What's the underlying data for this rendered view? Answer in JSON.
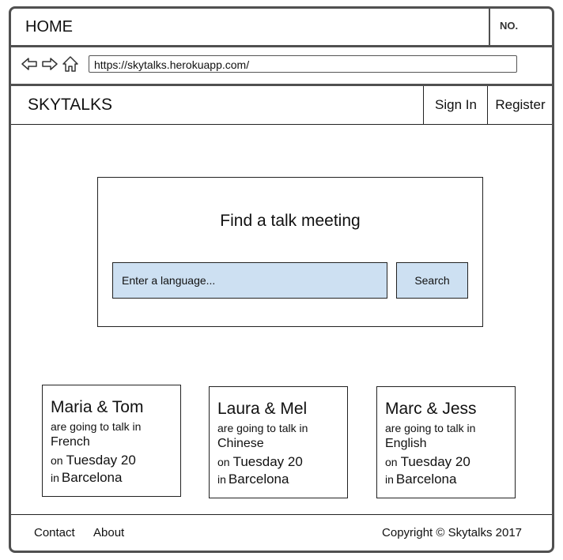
{
  "window": {
    "tab_title": "HOME",
    "no_label": "NO."
  },
  "browser": {
    "url": "https://skytalks.herokuapp.com/",
    "icons": [
      "back-arrow-icon",
      "forward-arrow-icon",
      "home-icon"
    ]
  },
  "header": {
    "brand": "SKYTALKS",
    "sign_in": "Sign In",
    "register": "Register"
  },
  "search": {
    "title": "Find a talk meeting",
    "placeholder": "Enter a language...",
    "button": "Search"
  },
  "cards": [
    {
      "names": "Maria & Tom",
      "line1": "are going to talk in",
      "language": "French",
      "on": "on",
      "day": "Tuesday 20",
      "in": "in",
      "city": "Barcelona"
    },
    {
      "names": "Laura & Mel",
      "line1": "are going to talk in",
      "language": "Chinese",
      "on": "on",
      "day": "Tuesday 20",
      "in": "in",
      "city": "Barcelona"
    },
    {
      "names": "Marc & Jess",
      "line1": "are going to talk in",
      "language": "English",
      "on": "on",
      "day": "Tuesday 20",
      "in": "in",
      "city": "Barcelona"
    }
  ],
  "footer": {
    "contact": "Contact",
    "about": "About",
    "copyright": "Copyright © Skytalks 2017"
  }
}
